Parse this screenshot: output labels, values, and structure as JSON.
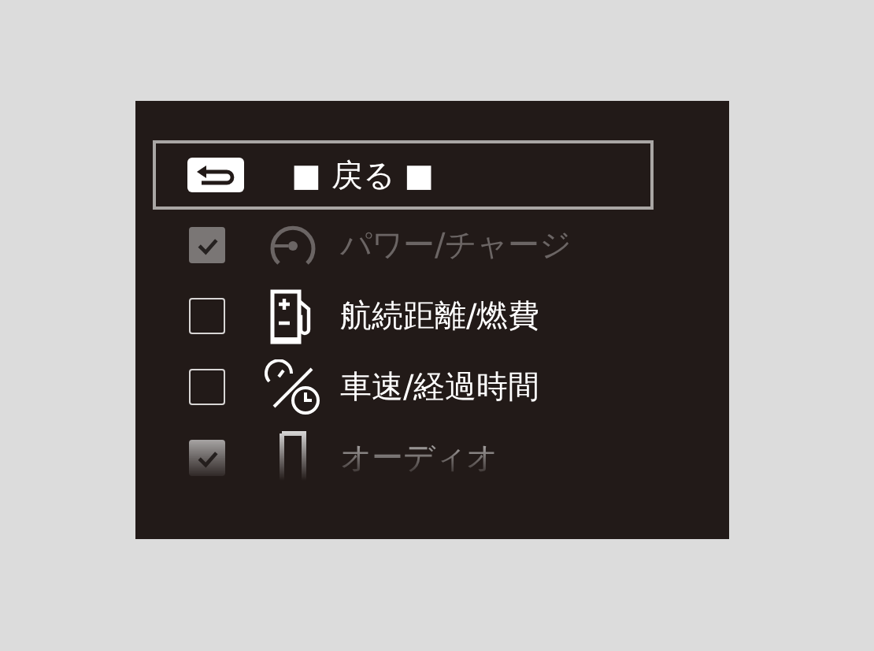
{
  "back_button": {
    "label": "■ 戻る ■",
    "selected": true
  },
  "items": [
    {
      "label": "パワー/チャージ",
      "kind": "power",
      "checked": true,
      "disabled": true
    },
    {
      "label": "航続距離/燃費",
      "kind": "fuel",
      "checked": false,
      "disabled": false
    },
    {
      "label": "車速/経過時間",
      "kind": "speed",
      "checked": false,
      "disabled": false
    },
    {
      "label": "オーディオ",
      "kind": "audio",
      "checked": true,
      "disabled": false
    }
  ]
}
